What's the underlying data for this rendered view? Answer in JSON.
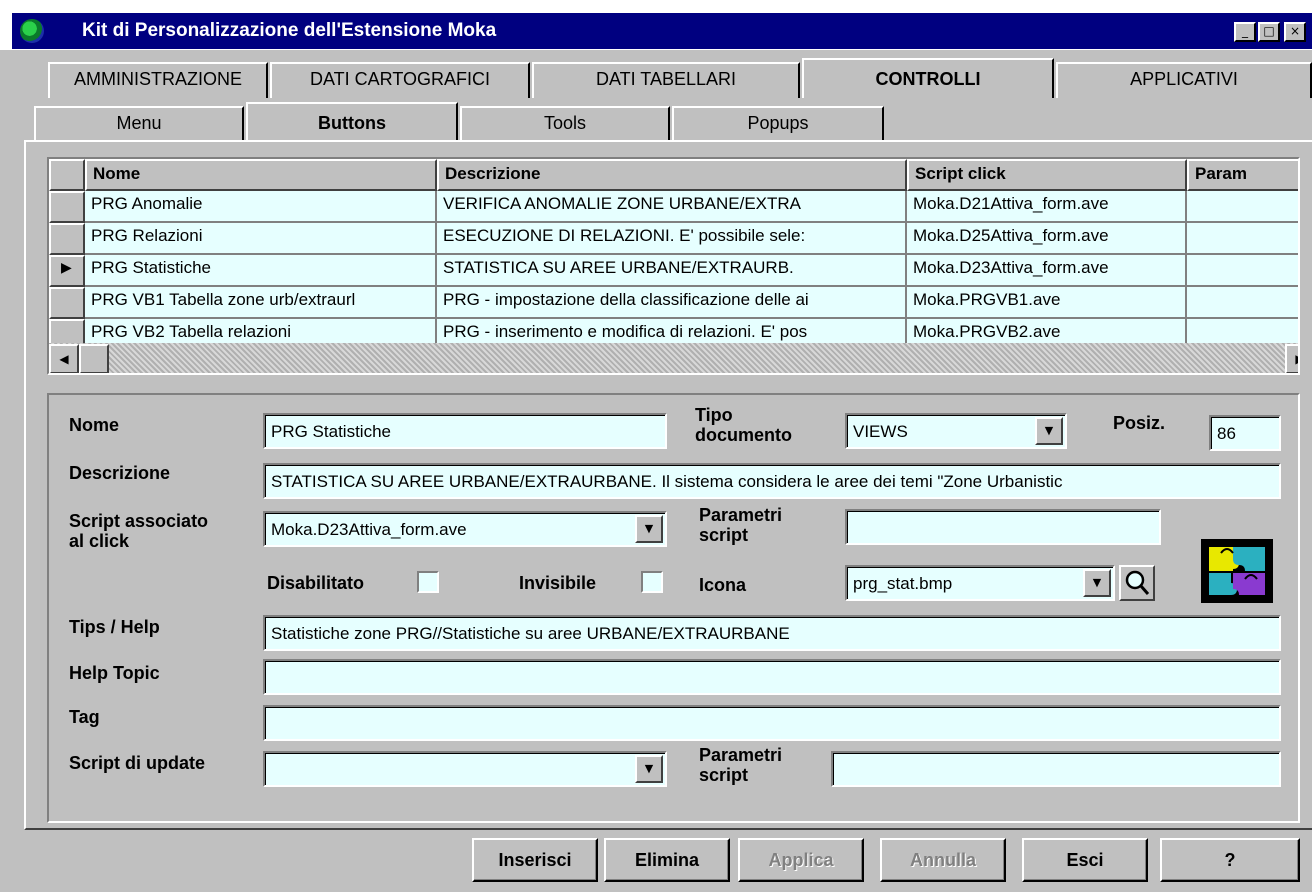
{
  "window": {
    "title": "Kit di Personalizzazione dell'Estensione Moka",
    "minimize": "_",
    "maximize": "□",
    "close": "×"
  },
  "tabs": [
    "AMMINISTRAZIONE",
    "DATI CARTOGRAFICI",
    "DATI TABELLARI",
    "CONTROLLI",
    "APPLICATIVI"
  ],
  "active_tab": "CONTROLLI",
  "subtabs": [
    "Menu",
    "Buttons",
    "Tools",
    "Popups"
  ],
  "active_subtab": "Buttons",
  "grid": {
    "columns": [
      "Nome",
      "Descrizione",
      "Script click",
      "Param"
    ],
    "rows": [
      [
        "PRG Anomalie",
        "VERIFICA ANOMALIE ZONE URBANE/EXTRA",
        "Moka.D21Attiva_form.ave",
        ""
      ],
      [
        "PRG Relazioni",
        "ESECUZIONE DI RELAZIONI. E' possibile sele:",
        "Moka.D25Attiva_form.ave",
        ""
      ],
      [
        "PRG Statistiche",
        "STATISTICA SU AREE URBANE/EXTRAURB.",
        "Moka.D23Attiva_form.ave",
        ""
      ],
      [
        "PRG VB1 Tabella zone urb/extraurl",
        "PRG - impostazione della classificazione delle ai",
        "Moka.PRGVB1.ave",
        ""
      ],
      [
        "PRG VB2 Tabella relazioni",
        "PRG - inserimento e modifica di relazioni. E' pos",
        "Moka.PRGVB2.ave",
        ""
      ]
    ],
    "selected_marker": "▶",
    "scroll_up": "▲",
    "scroll_down": "▼",
    "scroll_left": "◀",
    "scroll_right": "▶"
  },
  "form": {
    "nome_label": "Nome",
    "nome_value": "PRG Statistiche",
    "tipo_label": "Tipo\ndocumento",
    "tipo_value": "VIEWS",
    "posiz_label": "Posiz.",
    "posiz_value": "86",
    "descrizione_label": "Descrizione",
    "descrizione_value": "STATISTICA SU AREE URBANE/EXTRAURBANE. Il sistema considera le aree dei temi \"Zone Urbanistic",
    "script_label": "Script associato\nal click",
    "script_value": "Moka.D23Attiva_form.ave",
    "parametri_label": "Parametri\nscript",
    "parametri_value": "",
    "disabilitato_label": "Disabilitato",
    "invisibile_label": "Invisibile",
    "icona_label": "Icona",
    "icona_value": "prg_stat.bmp",
    "tips_label": "Tips / Help",
    "tips_value": "Statistiche zone PRG//Statistiche su aree URBANE/EXTRAURBANE",
    "helptopic_label": "Help Topic",
    "helptopic_value": "",
    "tag_label": "Tag",
    "tag_value": "",
    "update_label": "Script di update",
    "update_value": "",
    "parametri2_label": "Parametri\nscript",
    "parametri2_value": "",
    "dropdown_arrow": "▼"
  },
  "buttons": {
    "inserisci": "Inserisci",
    "elimina": "Elimina",
    "applica": "Applica",
    "annulla": "Annulla",
    "esci": "Esci",
    "help": "?"
  }
}
